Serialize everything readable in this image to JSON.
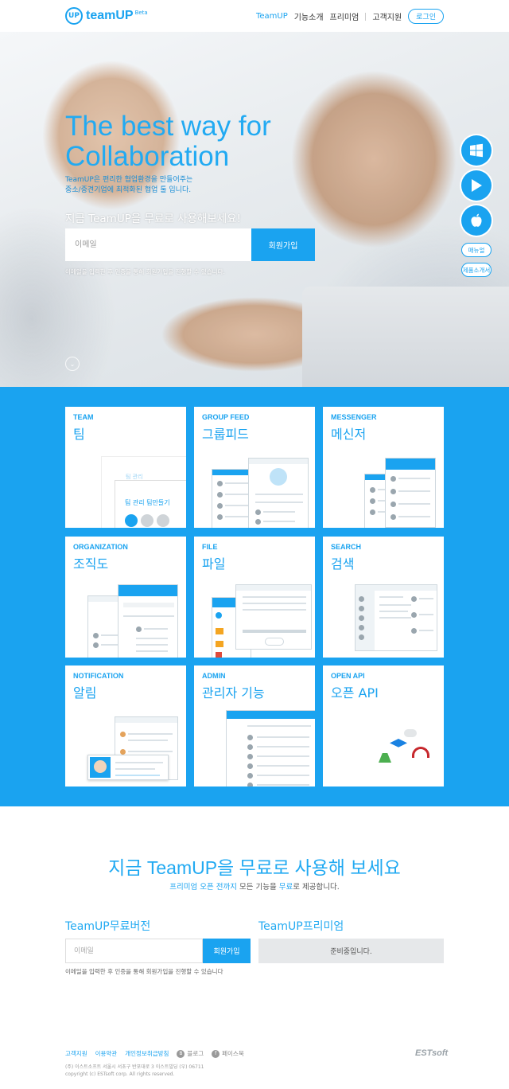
{
  "header": {
    "logo_mark": "UP",
    "logo_text": "teamUP",
    "logo_beta": "Beta",
    "nav": [
      "TeamUP",
      "기능소개",
      "프리미엄",
      "고객지원"
    ],
    "login": "로그인"
  },
  "hero": {
    "title_line1": "The best way for",
    "title_line2": "Collaboration",
    "desc_line1": "TeamUP은 편리한 협업환경을 만들어주는",
    "desc_line2": "중소/중견기업에 최적화된 협업 툴 입니다.",
    "cta": "지금 TeamUP을 무료로 사용해보세요!",
    "email_placeholder": "이메일",
    "join_label": "회원가입",
    "note": "이메일을 입력한 후 인증을 통해 회원가입을 진행할 수 있습니다."
  },
  "side": {
    "manual": "매뉴얼",
    "brochure": "제품소개서"
  },
  "features": [
    {
      "en": "TEAM",
      "ko": "팀"
    },
    {
      "en": "GROUP FEED",
      "ko": "그룹피드"
    },
    {
      "en": "MESSENGER",
      "ko": "메신저"
    },
    {
      "en": "ORGANIZATION",
      "ko": "조직도"
    },
    {
      "en": "FILE",
      "ko": "파일"
    },
    {
      "en": "SEARCH",
      "ko": "검색"
    },
    {
      "en": "NOTIFICATION",
      "ko": "알림"
    },
    {
      "en": "ADMIN",
      "ko": "관리자 기능"
    },
    {
      "en": "OPEN API",
      "ko": "오픈 API"
    }
  ],
  "team_card": {
    "text1": "팀 관리",
    "text2": "팀 관리 팀만들기"
  },
  "bottom": {
    "title": "지금 TeamUP을 무료로 사용해 보세요",
    "sub_hl": "프리미엄 오픈 전까지",
    "sub_mid": " 모든 기능을 ",
    "sub_hl2": "무료",
    "sub_end": "로 제공합니다.",
    "free_title": "TeamUP무료버전",
    "premium_title": "TeamUP프리미엄",
    "email_placeholder": "이메일",
    "join_label": "회원가입",
    "preparing": "준비중입니다.",
    "note": "이메일을 입력한 후 인증을 통해 회원가입을 진행할 수 있습니다"
  },
  "footer": {
    "links": [
      "고객지원",
      "이용약관",
      "개인정보취급방침"
    ],
    "blog": "블로그",
    "facebook": "페이스북",
    "blog_icon": "B",
    "facebook_icon": "f",
    "brand": "ESTsoft",
    "address": "(주) 이스트소프트 서울시 서초구 반포대로 3 이스트빌딩 (우) 06711",
    "copyright": "copyright (c) ESTsoft corp. All rights reserved."
  },
  "colors": {
    "accent": "#1aa3f0"
  }
}
